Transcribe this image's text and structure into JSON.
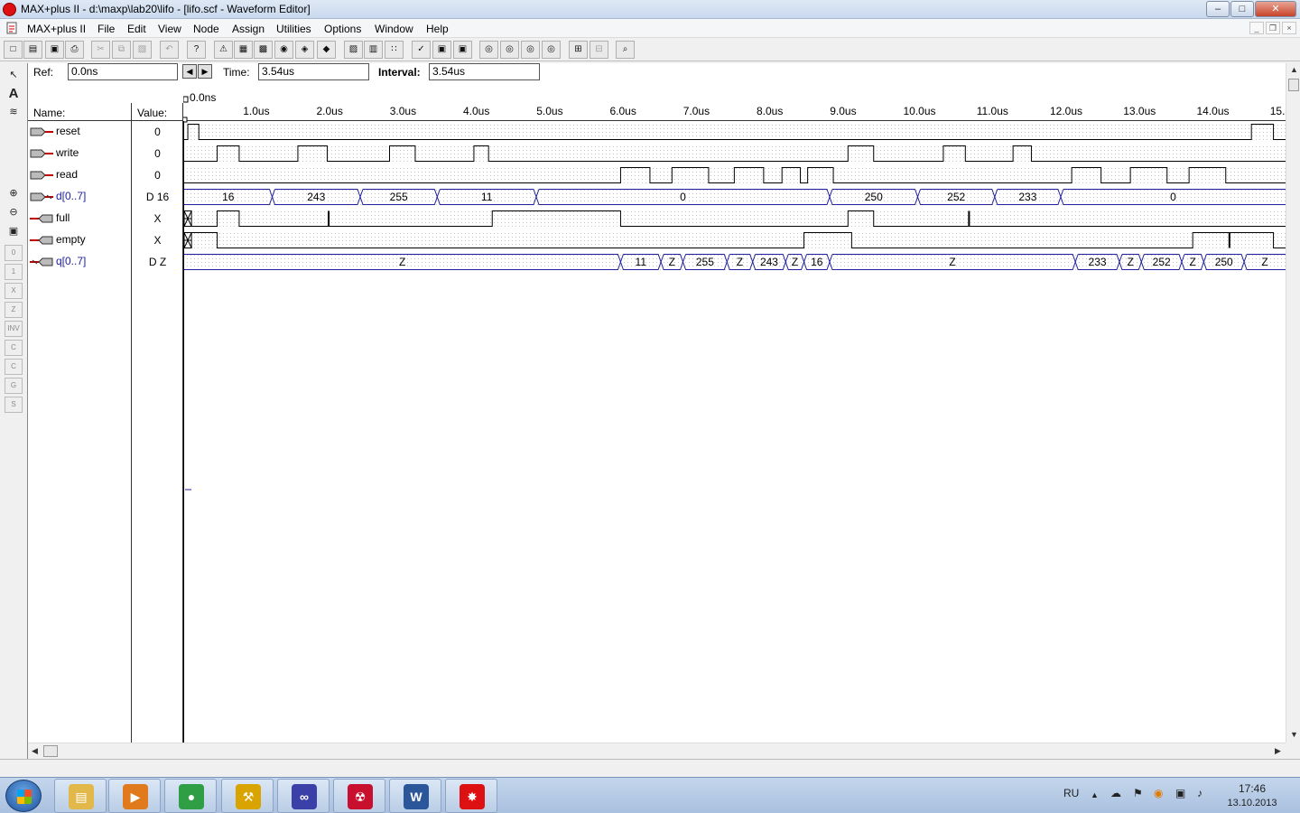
{
  "window": {
    "title": "MAX+plus II - d:\\maxp\\lab20\\lifo - [lifo.scf - Waveform Editor]",
    "minimize": "–",
    "maximize": "□",
    "close": "✕"
  },
  "menu": {
    "app": "MAX+plus II",
    "items": [
      "File",
      "Edit",
      "View",
      "Node",
      "Assign",
      "Utilities",
      "Options",
      "Window",
      "Help"
    ],
    "mdi_minimize": "_",
    "mdi_restore": "❐",
    "mdi_close": "×"
  },
  "toolbar": {
    "buttons": [
      {
        "name": "new-icon",
        "glyph": "□"
      },
      {
        "name": "open-icon",
        "glyph": "▤"
      },
      {
        "name": "save-icon",
        "glyph": "▣"
      },
      {
        "name": "print-icon",
        "glyph": "⎙"
      },
      {
        "name": "cut-icon",
        "glyph": "✂"
      },
      {
        "name": "copy-icon",
        "glyph": "⧉"
      },
      {
        "name": "paste-icon",
        "glyph": "▧"
      },
      {
        "name": "undo-icon",
        "glyph": "↶"
      },
      {
        "name": "help-icon",
        "glyph": "?"
      },
      {
        "name": "warning-icon",
        "glyph": "⚠"
      },
      {
        "name": "hierarchy-icon",
        "glyph": "▦"
      },
      {
        "name": "floorplan-icon",
        "glyph": "▩"
      },
      {
        "name": "compiler-icon",
        "glyph": "◉"
      },
      {
        "name": "simulator-icon",
        "glyph": "◈"
      },
      {
        "name": "timing-icon",
        "glyph": "◆"
      },
      {
        "name": "programmer-icon",
        "glyph": "▨"
      },
      {
        "name": "project-icon",
        "glyph": "▥"
      },
      {
        "name": "tree-icon",
        "glyph": "∷"
      },
      {
        "name": "save-check-icon",
        "glyph": "✓"
      },
      {
        "name": "save-sim-icon",
        "glyph": "▣"
      },
      {
        "name": "save-timing-icon",
        "glyph": "▣"
      },
      {
        "name": "find-node-icon",
        "glyph": "◎"
      },
      {
        "name": "find-text-icon",
        "glyph": "◎"
      },
      {
        "name": "find-next-icon",
        "glyph": "◎"
      },
      {
        "name": "find-eye-icon",
        "glyph": "◎"
      },
      {
        "name": "tile-icon",
        "glyph": "⊞"
      },
      {
        "name": "cascade-icon",
        "glyph": "⊟"
      },
      {
        "name": "zoom-fit-icon",
        "glyph": "⌕"
      }
    ]
  },
  "palette": {
    "tools": [
      {
        "name": "selection-tool-icon",
        "glyph": "↖"
      },
      {
        "name": "text-tool-icon",
        "glyph": "A"
      },
      {
        "name": "waveform-draw-tool-icon",
        "glyph": "≋"
      },
      {
        "name": "zoom-in-icon",
        "glyph": "⊕"
      },
      {
        "name": "zoom-out-icon",
        "glyph": "⊖"
      },
      {
        "name": "fit-in-window-icon",
        "glyph": "▣"
      }
    ],
    "level_tools": [
      "0",
      "1",
      "X",
      "Z",
      "INV",
      "C",
      "C",
      "G",
      "S"
    ]
  },
  "ref_bar": {
    "ref_label": "Ref:",
    "ref_value": "0.0ns",
    "time_label": "Time:",
    "time_value": "3.54us",
    "interval_label": "Interval:",
    "interval_value": "3.54us",
    "prev_glyph": "◀",
    "next_glyph": "▶"
  },
  "columns": {
    "name": "Name:",
    "value": "Value:"
  },
  "timeline": {
    "ref_marker": "0.0ns",
    "ticks": [
      {
        "t": 1.0,
        "label": "1.0us"
      },
      {
        "t": 2.0,
        "label": "2.0us"
      },
      {
        "t": 3.0,
        "label": "3.0us"
      },
      {
        "t": 4.0,
        "label": "4.0us"
      },
      {
        "t": 5.0,
        "label": "5.0us"
      },
      {
        "t": 6.0,
        "label": "6.0us"
      },
      {
        "t": 7.0,
        "label": "7.0us"
      },
      {
        "t": 8.0,
        "label": "8.0us"
      },
      {
        "t": 9.0,
        "label": "9.0us"
      },
      {
        "t": 10.0,
        "label": "10.0us"
      },
      {
        "t": 11.0,
        "label": "11.0us"
      },
      {
        "t": 12.0,
        "label": "12.0us"
      },
      {
        "t": 13.0,
        "label": "13.0us"
      },
      {
        "t": 14.0,
        "label": "14.0us"
      },
      {
        "t": 15.0,
        "label": "15."
      }
    ],
    "end_time": 15.1
  },
  "signals": [
    {
      "name": "reset",
      "type": "input",
      "value": "0",
      "kind": "bit",
      "edges": [
        [
          0,
          0
        ],
        [
          0.05,
          1
        ],
        [
          0.2,
          0
        ],
        [
          14.55,
          1
        ],
        [
          14.85,
          0
        ]
      ]
    },
    {
      "name": "write",
      "type": "input",
      "value": "0",
      "kind": "bit",
      "edges": [
        [
          0,
          0
        ],
        [
          0.45,
          1
        ],
        [
          0.75,
          0
        ],
        [
          1.55,
          1
        ],
        [
          1.95,
          0
        ],
        [
          2.8,
          1
        ],
        [
          3.15,
          0
        ],
        [
          3.95,
          1
        ],
        [
          4.15,
          0
        ],
        [
          9.05,
          1
        ],
        [
          9.4,
          0
        ],
        [
          10.35,
          1
        ],
        [
          10.65,
          0
        ],
        [
          11.3,
          1
        ],
        [
          11.55,
          0
        ]
      ]
    },
    {
      "name": "read",
      "type": "input",
      "value": "0",
      "kind": "bit",
      "edges": [
        [
          0,
          0
        ],
        [
          5.95,
          1
        ],
        [
          6.35,
          0
        ],
        [
          6.65,
          1
        ],
        [
          7.15,
          0
        ],
        [
          7.5,
          1
        ],
        [
          7.9,
          0
        ],
        [
          8.15,
          1
        ],
        [
          8.4,
          0
        ],
        [
          8.5,
          1
        ],
        [
          8.85,
          0
        ],
        [
          12.1,
          1
        ],
        [
          12.5,
          0
        ],
        [
          12.9,
          1
        ],
        [
          13.4,
          0
        ],
        [
          13.7,
          1
        ],
        [
          14.2,
          0
        ]
      ]
    },
    {
      "name": "d[0..7]",
      "type": "input",
      "value": "D 16",
      "kind": "bus",
      "segments": [
        [
          0,
          1.2,
          "16"
        ],
        [
          1.2,
          2.4,
          "243"
        ],
        [
          2.4,
          3.45,
          "255"
        ],
        [
          3.45,
          4.8,
          "11"
        ],
        [
          4.8,
          8.8,
          "0"
        ],
        [
          8.8,
          10.0,
          "250"
        ],
        [
          10.0,
          11.05,
          "252"
        ],
        [
          11.05,
          11.95,
          "233"
        ],
        [
          11.95,
          15.1,
          "0"
        ]
      ]
    },
    {
      "name": "full",
      "type": "output",
      "value": "X",
      "kind": "bit",
      "unknown_until": 0.1,
      "edges": [
        [
          0.1,
          0
        ],
        [
          0.45,
          1
        ],
        [
          0.75,
          0
        ],
        [
          4.2,
          1
        ],
        [
          5.95,
          0
        ],
        [
          9.05,
          1
        ],
        [
          9.4,
          0
        ]
      ],
      "glitches": [
        1.97,
        10.7
      ]
    },
    {
      "name": "empty",
      "type": "output",
      "value": "X",
      "kind": "bit",
      "unknown_until": 0.1,
      "edges": [
        [
          0.1,
          1
        ],
        [
          0.45,
          0
        ],
        [
          8.45,
          1
        ],
        [
          9.1,
          0
        ],
        [
          13.75,
          1
        ],
        [
          14.85,
          0
        ]
      ],
      "glitches": [
        14.25
      ]
    },
    {
      "name": "q[0..7]",
      "type": "output",
      "value": "D Z",
      "kind": "bus",
      "segments": [
        [
          0,
          5.95,
          "Z"
        ],
        [
          5.95,
          6.5,
          "11"
        ],
        [
          6.5,
          6.8,
          "Z"
        ],
        [
          6.8,
          7.4,
          "255"
        ],
        [
          7.4,
          7.75,
          "Z"
        ],
        [
          7.75,
          8.2,
          "243"
        ],
        [
          8.2,
          8.45,
          "Z"
        ],
        [
          8.45,
          8.8,
          "16"
        ],
        [
          8.8,
          12.15,
          "Z"
        ],
        [
          12.15,
          12.75,
          "233"
        ],
        [
          12.75,
          13.05,
          "Z"
        ],
        [
          13.05,
          13.6,
          "252"
        ],
        [
          13.6,
          13.9,
          "Z"
        ],
        [
          13.9,
          14.45,
          "250"
        ],
        [
          14.45,
          15.1,
          "Z"
        ]
      ]
    }
  ],
  "taskbar": {
    "apps": [
      {
        "name": "explorer-taskbar-icon",
        "glyph": "▤",
        "color": "#e2b84a"
      },
      {
        "name": "media-player-taskbar-icon",
        "glyph": "▶",
        "color": "#e07a1c"
      },
      {
        "name": "chrome-taskbar-icon",
        "glyph": "●",
        "color": "#2f9e44"
      },
      {
        "name": "tools-taskbar-icon",
        "glyph": "⚒",
        "color": "#d9a400"
      },
      {
        "name": "infinity-taskbar-icon",
        "glyph": "∞",
        "color": "#3b3fa8"
      },
      {
        "name": "pdf-reader-taskbar-icon",
        "glyph": "☢",
        "color": "#c8102e"
      },
      {
        "name": "word-taskbar-icon",
        "glyph": "W",
        "color": "#2b579a"
      },
      {
        "name": "maxplus-taskbar-icon",
        "glyph": "✸",
        "color": "#d11"
      }
    ],
    "lang": "RU",
    "time": "17:46",
    "date": "13.10.2013"
  },
  "colors": {
    "bus_text": "#2020a0",
    "output_pin": "#c00000",
    "wave": "#000000",
    "grid": "#c8c8c8"
  }
}
